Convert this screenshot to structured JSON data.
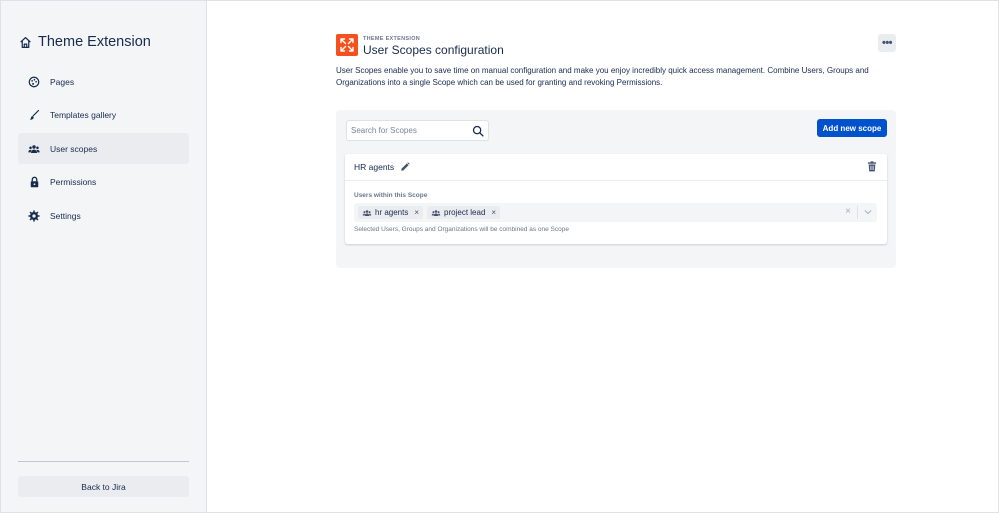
{
  "sidebar": {
    "app_title": "Theme Extension",
    "items": [
      {
        "label": "Pages",
        "icon": "palette-icon",
        "active": false
      },
      {
        "label": "Templates gallery",
        "icon": "brush-icon",
        "active": false
      },
      {
        "label": "User scopes",
        "icon": "users-icon",
        "active": true
      },
      {
        "label": "Permissions",
        "icon": "lock-icon",
        "active": false
      },
      {
        "label": "Settings",
        "icon": "gear-icon",
        "active": false
      }
    ],
    "back_label": "Back to Jira"
  },
  "header": {
    "overline": "THEME EXTENSION",
    "title": "User Scopes configuration",
    "more_label": "•••",
    "brand_color": "#f4511e"
  },
  "description": "User Scopes enable you to save time on manual configuration and make you enjoy incredibly quick access management. Combine Users, Groups and Organizations into a single Scope which can be used for granting and revoking Permissions.",
  "toolbar": {
    "search_placeholder": "Search for Scopes",
    "add_label": "Add new scope",
    "accent_color": "#0052cc"
  },
  "scopes": [
    {
      "name": "HR agents",
      "field_label": "Users within this Scope",
      "tags": [
        {
          "label": "hr agents",
          "icon": "group-icon"
        },
        {
          "label": "project lead",
          "icon": "group-icon"
        }
      ],
      "helper": "Selected Users, Groups and Organizations will be combined as one Scope"
    }
  ]
}
